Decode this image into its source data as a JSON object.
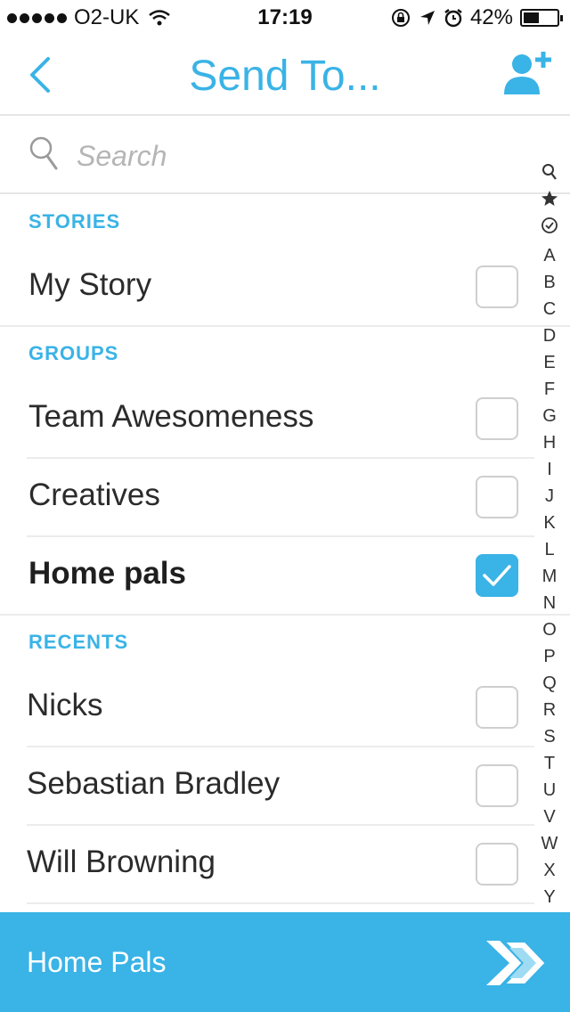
{
  "status_bar": {
    "carrier": "O2-UK",
    "time": "17:19",
    "battery": "42%",
    "battery_level": 0.42
  },
  "nav": {
    "title": "Send To..."
  },
  "search": {
    "placeholder": "Search"
  },
  "sections": {
    "stories": {
      "header": "STORIES",
      "items": [
        {
          "label": "My Story",
          "checked": false
        }
      ]
    },
    "groups": {
      "header": "GROUPS",
      "items": [
        {
          "label": "Team Awesomeness",
          "checked": false
        },
        {
          "label": "Creatives",
          "checked": false
        },
        {
          "label": "Home pals",
          "checked": true
        }
      ]
    },
    "recents": {
      "header": "RECENTS",
      "items": [
        {
          "label": "Nicks",
          "checked": false
        },
        {
          "label": "Sebastian Bradley",
          "checked": false
        },
        {
          "label": "Will Browning",
          "checked": false
        }
      ]
    }
  },
  "index_letters": [
    "A",
    "B",
    "C",
    "D",
    "E",
    "F",
    "G",
    "H",
    "I",
    "J",
    "K",
    "L",
    "M",
    "N",
    "O",
    "P",
    "Q",
    "R",
    "S",
    "T",
    "U",
    "V",
    "W",
    "X",
    "Y"
  ],
  "bottom_bar": {
    "label": "Home Pals"
  },
  "colors": {
    "accent": "#3ab3e6",
    "text": "#2b2b2b",
    "divider": "#ececec"
  }
}
